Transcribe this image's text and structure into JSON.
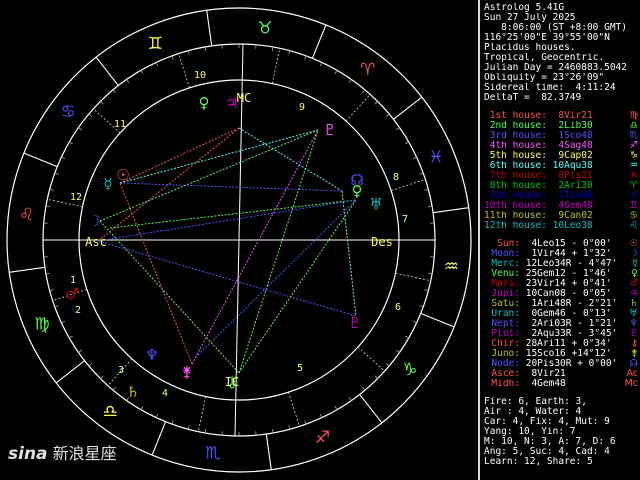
{
  "header": {
    "program": "Astrolog 5.41G",
    "date": "Sun 27 July 2025",
    "time": "8:06:00 (ST +8:00 GMT)",
    "location": "116°25'00\"E 39°55'00\"N",
    "houses": "Placidus houses.",
    "zodiac": "Tropical, Geocentric.",
    "julian": "Julian Day = 2460883.5042",
    "obliquity": "Obliquity = 23°26'09\"",
    "sidereal": "Sidereal time:  4:11:24",
    "deltat": "DeltaT =  82.3749"
  },
  "houses": [
    {
      "label": "1st house:",
      "value": " 8Vir21",
      "glyph": "♍",
      "color": "#ff5050"
    },
    {
      "label": "2nd house:",
      "value": " 2Lib30",
      "glyph": "♎",
      "color": "#50ff50"
    },
    {
      "label": "3rd house:",
      "value": " 1Sco48",
      "glyph": "♏",
      "color": "#5050ff"
    },
    {
      "label": "4th house:",
      "value": " 4Sag48",
      "glyph": "♐",
      "color": "#ff50ff"
    },
    {
      "label": "5th house:",
      "value": " 9Cap02",
      "glyph": "♑",
      "color": "#ffff50"
    },
    {
      "label": "6th house:",
      "value": "10Aqu38",
      "glyph": "♒",
      "color": "#50ffff"
    },
    {
      "label": "7th house:",
      "value": " 8Pis21",
      "glyph": "♓",
      "color": "#c00000"
    },
    {
      "label": "8th house:",
      "value": " 2Ari30",
      "glyph": "♈",
      "color": "#00c000"
    },
    {
      "label": "9th house:",
      "value": " 1Tau48",
      "glyph": "♉",
      "color": "#0000c0"
    },
    {
      "label": "10th house:",
      "value": " 4Gem48",
      "glyph": "♊",
      "color": "#c000c0"
    },
    {
      "label": "11th house:",
      "value": " 9Can02",
      "glyph": "♋",
      "color": "#c0c000"
    },
    {
      "label": "12th house:",
      "value": "10Leo38",
      "glyph": "♌",
      "color": "#00c0c0"
    }
  ],
  "planets": [
    {
      "name": "Sun:",
      "pos": " 4Leo15",
      "aspect": " - 0°00'",
      "glyph": "☉",
      "color": "#ff5050"
    },
    {
      "name": "Moon:",
      "pos": " 1Vir44",
      "aspect": " + 1°32'",
      "glyph": "☽",
      "color": "#5050ff"
    },
    {
      "name": "Merc:",
      "pos": "12Leo34R",
      "aspect": " - 4°47'",
      "glyph": "☿",
      "color": "#00c0c0"
    },
    {
      "name": "Venu:",
      "pos": "25Gem12",
      "aspect": " - 1°46'",
      "glyph": "♀",
      "color": "#50ff50"
    },
    {
      "name": "Mars:",
      "pos": "23Vir14",
      "aspect": " + 0°41'",
      "glyph": "♂",
      "color": "#c00000"
    },
    {
      "name": "Jupi:",
      "pos": "10Can08",
      "aspect": " - 0°05'",
      "glyph": "♃",
      "color": "#c000c0"
    },
    {
      "name": "Satu:",
      "pos": " 1Ari48R",
      "aspect": " - 2°21'",
      "glyph": "♄",
      "color": "#c0c000"
    },
    {
      "name": "Uran:",
      "pos": " 0Gem46",
      "aspect": " - 0°13'",
      "glyph": "♅",
      "color": "#00c0c0"
    },
    {
      "name": "Nept:",
      "pos": " 2Ari03R",
      "aspect": " - 1°21'",
      "glyph": "♆",
      "color": "#5050ff"
    },
    {
      "name": "Plut:",
      "pos": " 2Aqu33R",
      "aspect": " - 3°45'",
      "glyph": "♇",
      "color": "#c000c0"
    },
    {
      "name": "Chir:",
      "pos": "28Ari11",
      "aspect": " + 0°34'",
      "glyph": "⚷",
      "color": "#ff5050"
    },
    {
      "name": "Juno:",
      "pos": "15Sco16",
      "aspect": " +14°12'",
      "glyph": "⚵",
      "color": "#c0c000"
    },
    {
      "name": "Node:",
      "pos": "20Pis30R",
      "aspect": " + 0°00'",
      "glyph": "☊",
      "color": "#5050ff"
    },
    {
      "name": "Asce:",
      "pos": " 8Vir21",
      "aspect": "",
      "glyph": "Ac",
      "color": "#ff5050"
    },
    {
      "name": "Midh:",
      "pos": " 4Gem48",
      "aspect": "",
      "glyph": "Mc",
      "color": "#ff5050"
    }
  ],
  "stats": [
    "Fire: 6, Earth: 3,",
    "Air : 4, Water: 4",
    "Car: 4, Fix: 4, Mut: 9",
    "Yang: 10, Yin: 7",
    "M: 10, N: 3, A: 7, D: 6",
    "Ang: 5, Suc: 4, Cad: 4",
    "Learn: 12, Share: 5"
  ],
  "wheel": {
    "asc_label": "Asc",
    "des_label": "Des",
    "mc_label": "MC",
    "ic_label": "IC",
    "house_numbers": [
      "1",
      "2",
      "3",
      "4",
      "5",
      "6",
      "7",
      "8",
      "9",
      "10",
      "11",
      "12"
    ]
  },
  "watermark": {
    "brand": "sina",
    "text": "新浪星座"
  }
}
